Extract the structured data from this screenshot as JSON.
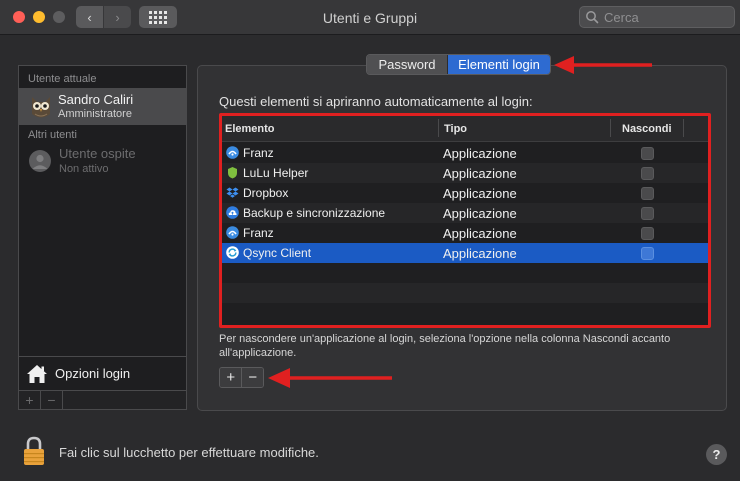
{
  "window": {
    "title": "Utenti e Gruppi"
  },
  "toolbar": {
    "back_label": "‹",
    "forward_label": "›",
    "search_placeholder": "Cerca"
  },
  "sidebar": {
    "current_user_section": "Utente attuale",
    "current_user": {
      "name": "Sandro Caliri",
      "role": "Amministratore"
    },
    "other_users_section": "Altri utenti",
    "guest_user": {
      "name": "Utente ospite",
      "status": "Non attivo"
    },
    "login_options_label": "Opzioni login",
    "add_label": "+",
    "remove_label": "−"
  },
  "tabs": [
    {
      "label": "Password",
      "selected": false
    },
    {
      "label": "Elementi login",
      "selected": true
    }
  ],
  "main": {
    "intro_text": "Questi elementi si apriranno automaticamente al login:",
    "columns": [
      "Elemento",
      "Tipo",
      "Nascondi"
    ],
    "rows": [
      {
        "name": "Franz",
        "type": "Applicazione",
        "icon": "franz-icon",
        "hide": false,
        "selected": false
      },
      {
        "name": "LuLu Helper",
        "type": "Applicazione",
        "icon": "lulu-shield-icon",
        "hide": false,
        "selected": false
      },
      {
        "name": "Dropbox",
        "type": "Applicazione",
        "icon": "dropbox-icon",
        "hide": false,
        "selected": false
      },
      {
        "name": "Backup e sincronizzazione",
        "type": "Applicazione",
        "icon": "google-backup-cloud-icon",
        "hide": false,
        "selected": false
      },
      {
        "name": "Franz",
        "type": "Applicazione",
        "icon": "franz-icon",
        "hide": false,
        "selected": false
      },
      {
        "name": "Qsync Client",
        "type": "Applicazione",
        "icon": "qsync-icon",
        "hide": false,
        "selected": true
      }
    ],
    "hint_text": "Per nascondere un'applicazione al login, seleziona l'opzione nella colonna Nascondi accanto all'applicazione.",
    "add_label": "+",
    "remove_label": "−"
  },
  "footer": {
    "lock_text": "Fai clic sul lucchetto per effettuare modifiche.",
    "help_label": "?"
  },
  "colors": {
    "accent": "#2e6bd1",
    "annotation": "#e02020"
  }
}
